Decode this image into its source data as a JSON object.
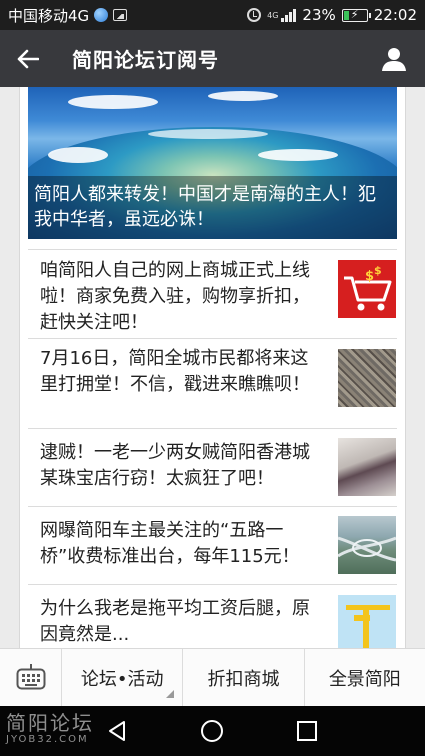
{
  "status": {
    "carrier": "中国移动4G",
    "network": "4G",
    "battery": "23%",
    "battery_level": 0.23,
    "time": "22:02"
  },
  "header": {
    "title": "简阳论坛订阅号"
  },
  "hero": {
    "caption": "简阳人都来转发！中国才是南海的主人！犯我中华者，虽远必诛！"
  },
  "articles": [
    {
      "title": "咱简阳人自己的网上商城正式上线啦！商家免费入驻，购物享折扣，赶快关注吧！",
      "thumb": "shopping-cart-image"
    },
    {
      "title": "7月16日，简阳全城市民都将来这里打拥堂！不信，戳进来瞧瞧呗！",
      "thumb": "crowd-image"
    },
    {
      "title": "逮贼！一老一少两女贼简阳香港城某珠宝店行窃！太疯狂了吧！",
      "thumb": "cctv-image"
    },
    {
      "title": "网曝简阳车主最关注的“五路一桥”收费标准出台，每年115元！",
      "thumb": "interchange-image"
    },
    {
      "title": "为什么我老是拖平均工资后腿，原因竟然是...",
      "thumb": "cartoon-image"
    }
  ],
  "bottom_nav": {
    "items": [
      "论坛•活动",
      "折扣商城",
      "全景简阳"
    ]
  },
  "watermark": {
    "name": "简阳论坛",
    "url": "JYOB32.COM"
  },
  "colors": {
    "header_bg": "#38393d",
    "status_bg": "#1e1e1e",
    "battery_green": "#3cc25a",
    "thumb_red": "#d61f1f"
  }
}
